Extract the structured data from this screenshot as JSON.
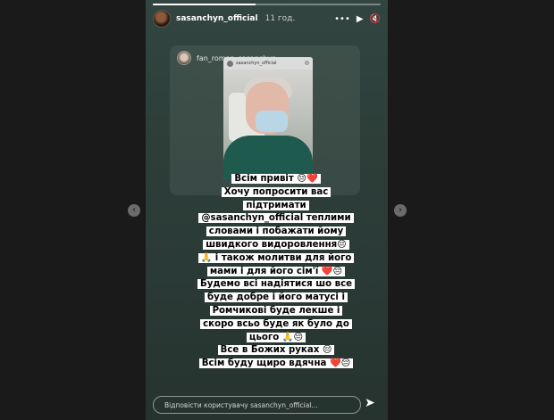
{
  "story": {
    "username": "sasanchyn_official",
    "time": "11 год.",
    "progress": 0.45,
    "icons": {
      "more": "more-icon",
      "play": "play-icon",
      "mute": "mute-icon"
    }
  },
  "repost": {
    "username": "fan_roman_sasanchyn",
    "inner_username": "sasanchyn_official"
  },
  "sticker_lines": [
    "Всім привіт 😔❤️",
    "Хочу попросити вас",
    "підтримати",
    "@sasanchyn_official  теплими",
    "словами і побажати йому",
    "швидкого видоровлення😔",
    "🙏 і також молитви для його",
    "мами і для його сім'ї ❤️😔",
    "Будемо всі надіятися шо все",
    "буде добре і його матусі і",
    "Ромчикові буде лекше і",
    "скоро всьо буде як було до",
    "цього 🙏😔",
    "Все в Божих руках 😔",
    "Всім буду щиро вдячна ❤️😔"
  ],
  "reply": {
    "placeholder": "Відповісти користувачу sasanchyn_official..."
  }
}
